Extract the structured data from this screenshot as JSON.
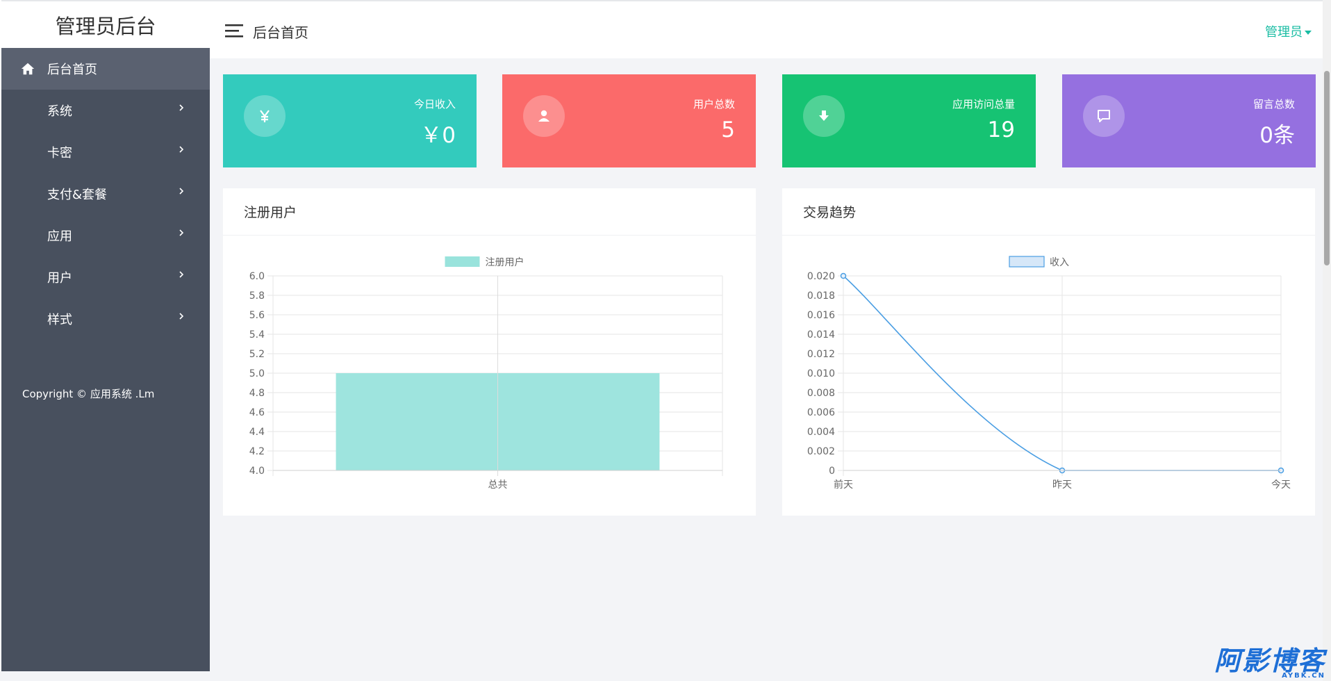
{
  "sidebar": {
    "brand": "管理员后台",
    "items": [
      {
        "label": "后台首页",
        "active": true,
        "icon": "home-icon"
      },
      {
        "label": "系统",
        "active": false
      },
      {
        "label": "卡密",
        "active": false
      },
      {
        "label": "支付&套餐",
        "active": false
      },
      {
        "label": "应用",
        "active": false
      },
      {
        "label": "用户",
        "active": false
      },
      {
        "label": "样式",
        "active": false
      }
    ],
    "copyright": "Copyright © 应用系统 .Lm"
  },
  "header": {
    "title": "后台首页",
    "user_menu": "管理员"
  },
  "stats": [
    {
      "label": "今日收入",
      "value": "￥0",
      "color": "#33cbbd",
      "icon": "yen-icon"
    },
    {
      "label": "用户总数",
      "value": "5",
      "color": "#fb6a6a",
      "icon": "user-icon"
    },
    {
      "label": "应用访问总量",
      "value": "19",
      "color": "#16c373",
      "icon": "download-icon"
    },
    {
      "label": "留言总数",
      "value": "0条",
      "color": "#9570e0",
      "icon": "message-icon"
    }
  ],
  "panels": {
    "registered_users": {
      "title": "注册用户"
    },
    "trade_trend": {
      "title": "交易趋势"
    }
  },
  "chart_data": [
    {
      "type": "bar",
      "categories": [
        "总共"
      ],
      "series": [
        {
          "name": "注册用户",
          "values": [
            5
          ],
          "color": "#99e3dc"
        }
      ],
      "ylim": [
        4.0,
        6.0
      ],
      "yticks": [
        "6.0",
        "5.8",
        "5.6",
        "5.4",
        "5.2",
        "5.0",
        "4.8",
        "4.6",
        "4.4",
        "4.2",
        "4.0"
      ],
      "grid": true,
      "legend": "top-center"
    },
    {
      "type": "line",
      "categories": [
        "前天",
        "昨天",
        "今天"
      ],
      "series": [
        {
          "name": "收入",
          "values": [
            0.02,
            0,
            0
          ],
          "color": "#4a9ee3"
        }
      ],
      "ylim": [
        0,
        0.02
      ],
      "yticks": [
        "0.020",
        "0.018",
        "0.016",
        "0.014",
        "0.012",
        "0.010",
        "0.008",
        "0.006",
        "0.004",
        "0.002",
        "0"
      ],
      "grid": true,
      "legend": "top-center"
    }
  ],
  "watermark": {
    "text": "阿影博客",
    "sub": "AYBK.CN"
  }
}
